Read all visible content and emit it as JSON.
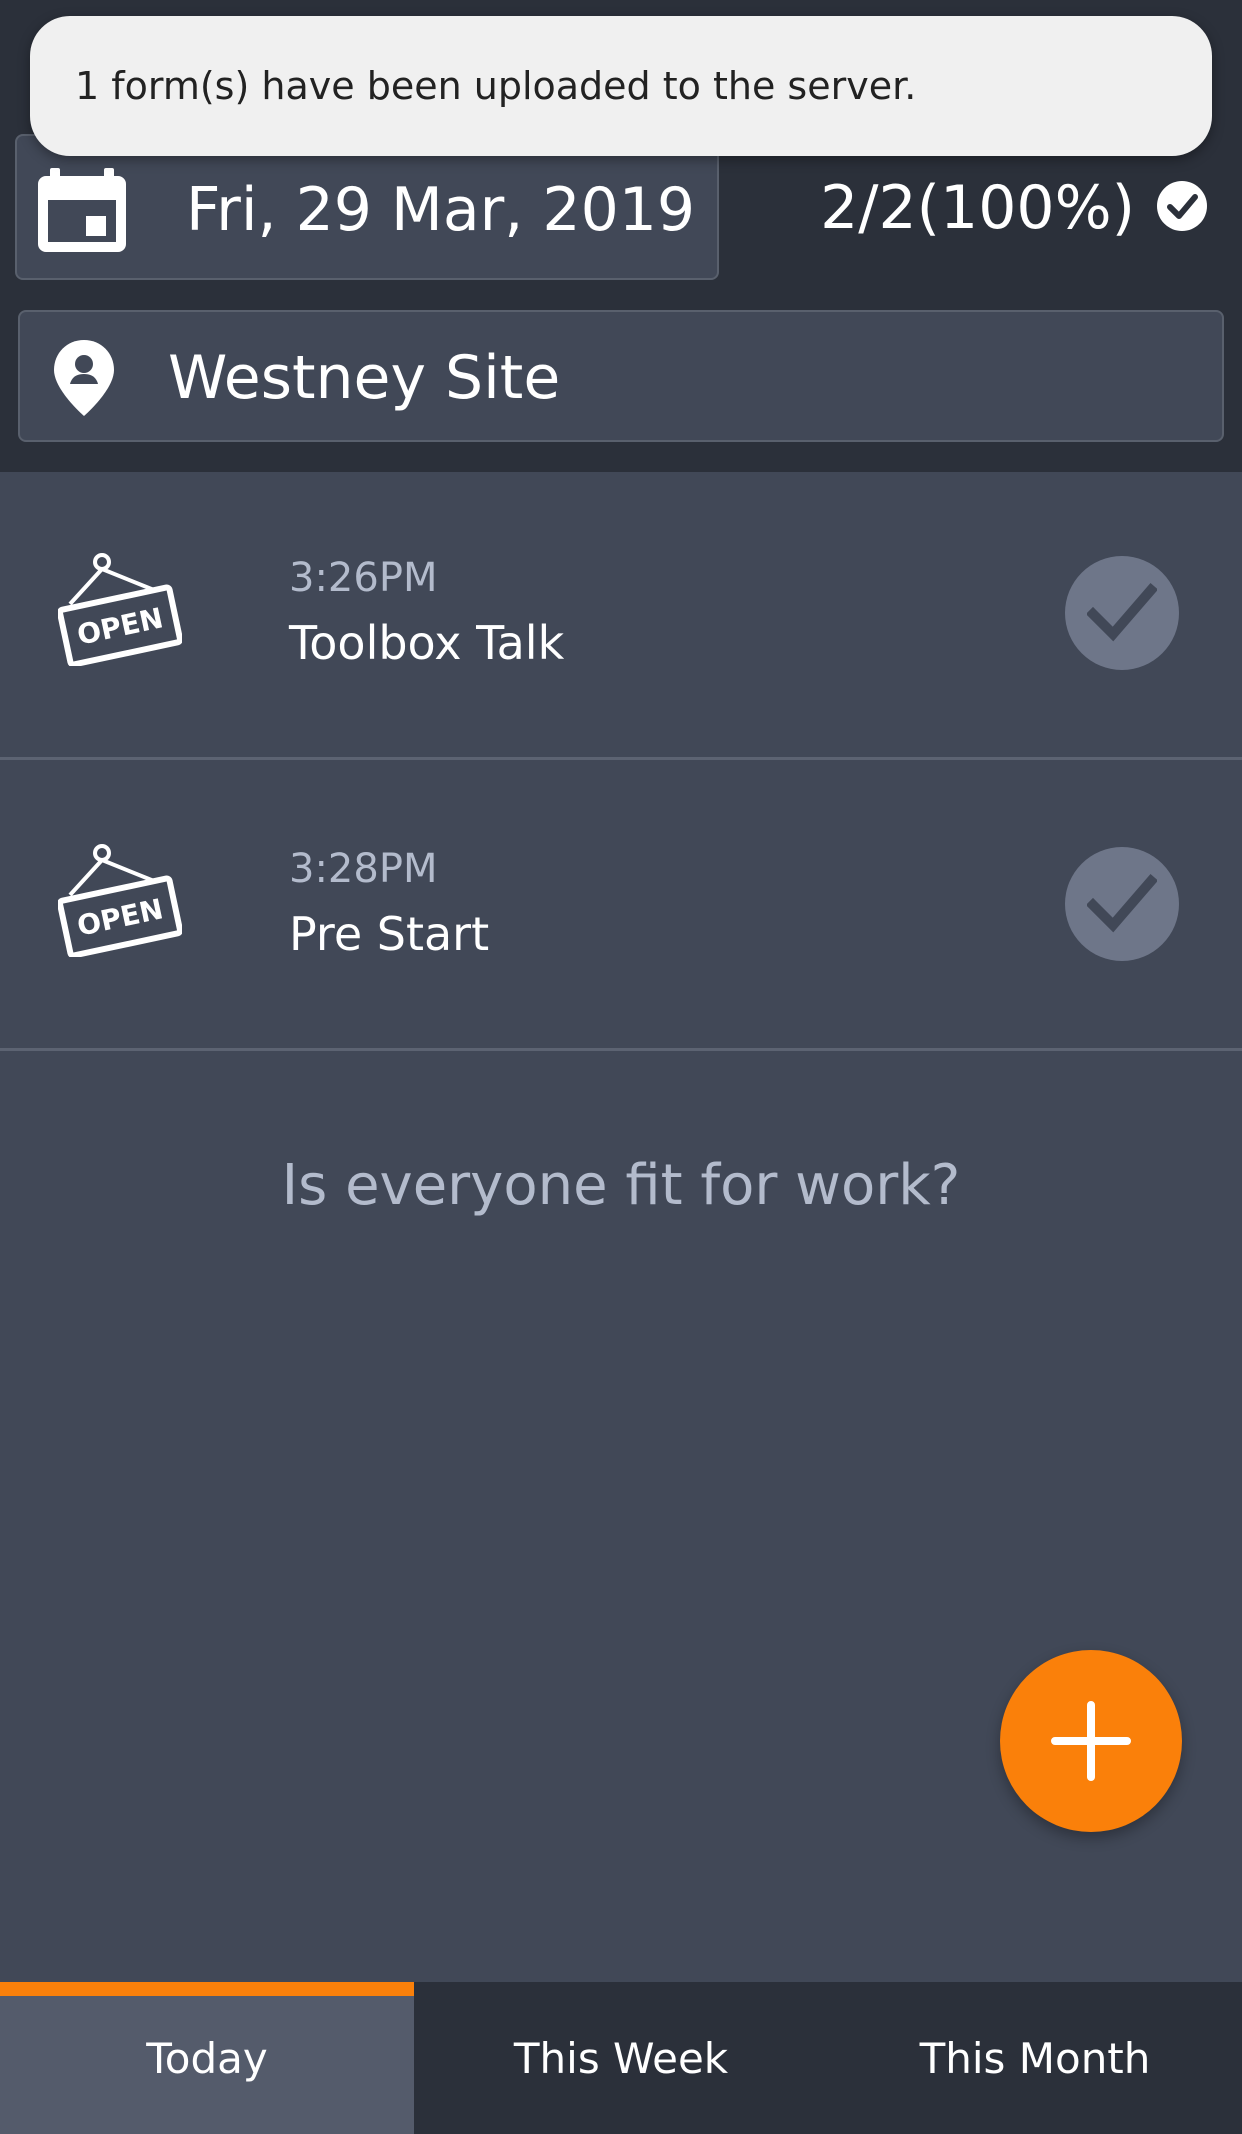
{
  "toast": {
    "message": "1 form(s) have been uploaded to the server."
  },
  "header": {
    "date": "Fri, 29 Mar, 2019",
    "progress": "2/2(100%)",
    "site": "Westney Site"
  },
  "forms": [
    {
      "time": "3:26PM",
      "title": "Toolbox Talk",
      "status_icon": "open-sign-icon",
      "completed": true
    },
    {
      "time": "3:28PM",
      "title": "Pre Start",
      "status_icon": "open-sign-icon",
      "completed": true
    }
  ],
  "prompt": "Is everyone fit for work?",
  "tabs": [
    {
      "label": "Today",
      "active": true
    },
    {
      "label": "This Week",
      "active": false
    },
    {
      "label": "This Month",
      "active": false
    }
  ],
  "colors": {
    "accent": "#fa800a",
    "header_bg": "#2b303a",
    "content_bg": "#414857",
    "muted_text": "#b3bbcc"
  }
}
